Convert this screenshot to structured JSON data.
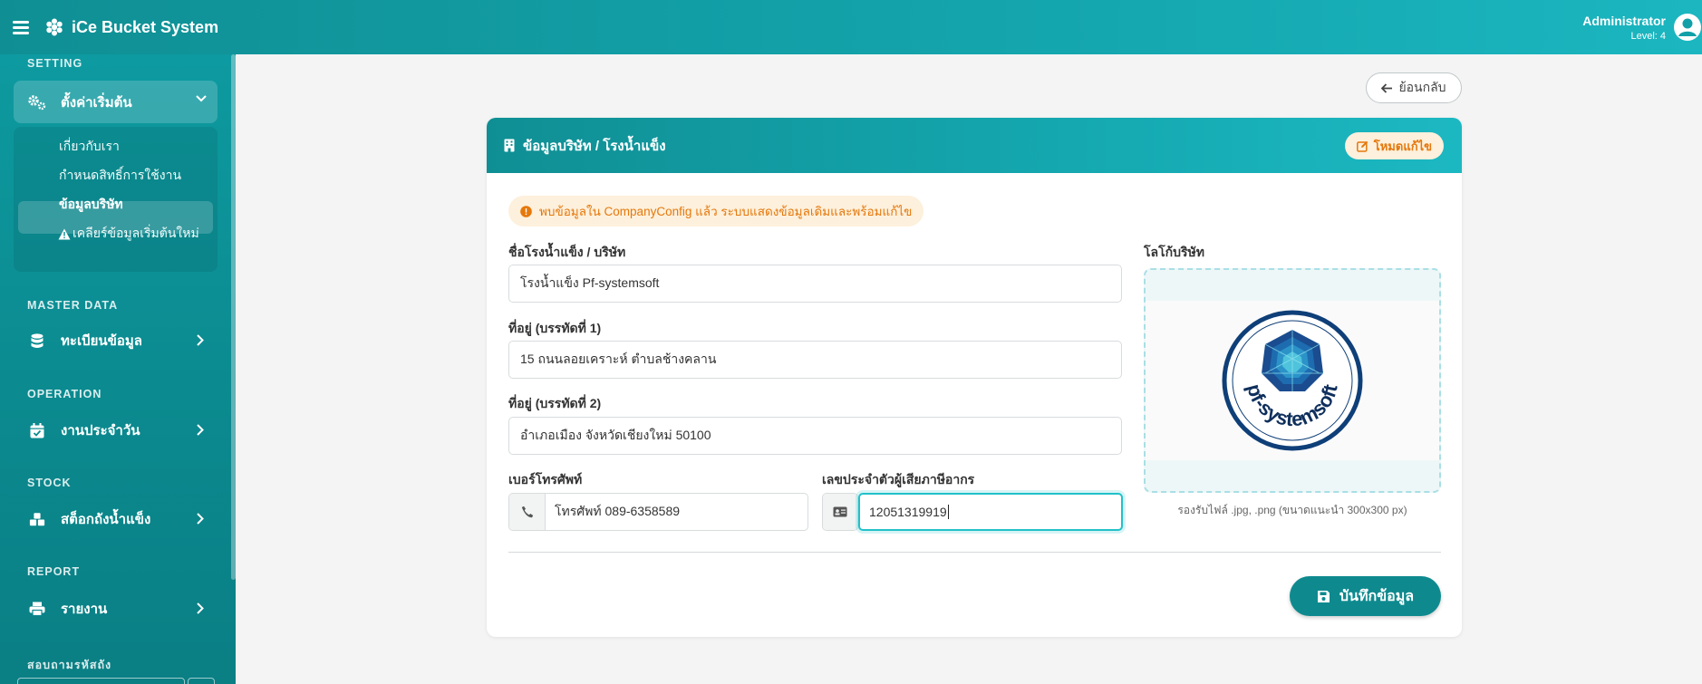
{
  "app": {
    "title": "iCe Bucket System"
  },
  "user": {
    "name": "Administrator",
    "level": "Level: 4"
  },
  "sidebar": {
    "sections": {
      "setting": "SETTING",
      "master_data": "MASTER DATA",
      "operation": "OPERATION",
      "stock": "STOCK",
      "report": "REPORT",
      "lookup": "สอบถามรหัสถัง"
    },
    "settings_menu": {
      "label": "ตั้งค่าเริ่มต้น",
      "items": [
        {
          "label": "เกี่ยวกับเรา"
        },
        {
          "label": "กำหนดสิทธิ์การใช้งาน"
        },
        {
          "label": "ข้อมูลบริษัท"
        },
        {
          "label": "เคลียร์ข้อมูลเริ่มต้นใหม่"
        }
      ]
    },
    "menus": {
      "registry": "ทะเบียนข้อมูล",
      "daily": "งานประจำวัน",
      "stock": "สต็อกถังน้ำแข็ง",
      "report": "รายงาน"
    }
  },
  "back_button": {
    "label": "ย้อนกลับ"
  },
  "card": {
    "title": "ข้อมูลบริษัท / โรงน้ำแข็ง",
    "edit_mode_label": "โหมดแก้ไข",
    "notice": "พบข้อมูลใน CompanyConfig แล้ว ระบบแสดงข้อมูลเดิมและพร้อมแก้ไข"
  },
  "form": {
    "company_name": {
      "label": "ชื่อโรงน้ำแข็ง / บริษัท",
      "value": "โรงน้ำแข็ง Pf-systemsoft"
    },
    "address1": {
      "label": "ที่อยู่ (บรรทัดที่ 1)",
      "value": "15 ถนนลอยเคราะห์ ตำบลช้างคลาน"
    },
    "address2": {
      "label": "ที่อยู่ (บรรทัดที่ 2)",
      "value": "อำเภอเมือง จังหวัดเชียงใหม่ 50100"
    },
    "phone": {
      "label": "เบอร์โทรศัพท์",
      "value": "โทรศัพท์ 089-6358589"
    },
    "tax_id": {
      "label": "เลขประจำตัวผู้เสียภาษีอากร",
      "value": "12051319919"
    },
    "logo": {
      "label": "โลโก้บริษัท",
      "hint": "รองรับไฟล์ .jpg, .png (ขนาดแนะนำ 300x300 px)",
      "text": "pf-systemsoft"
    },
    "save_label": "บันทึกข้อมูล"
  },
  "colors": {
    "primary": "#0f8f94",
    "accent": "#e5780c",
    "notice_bg": "#fdf0dc"
  }
}
